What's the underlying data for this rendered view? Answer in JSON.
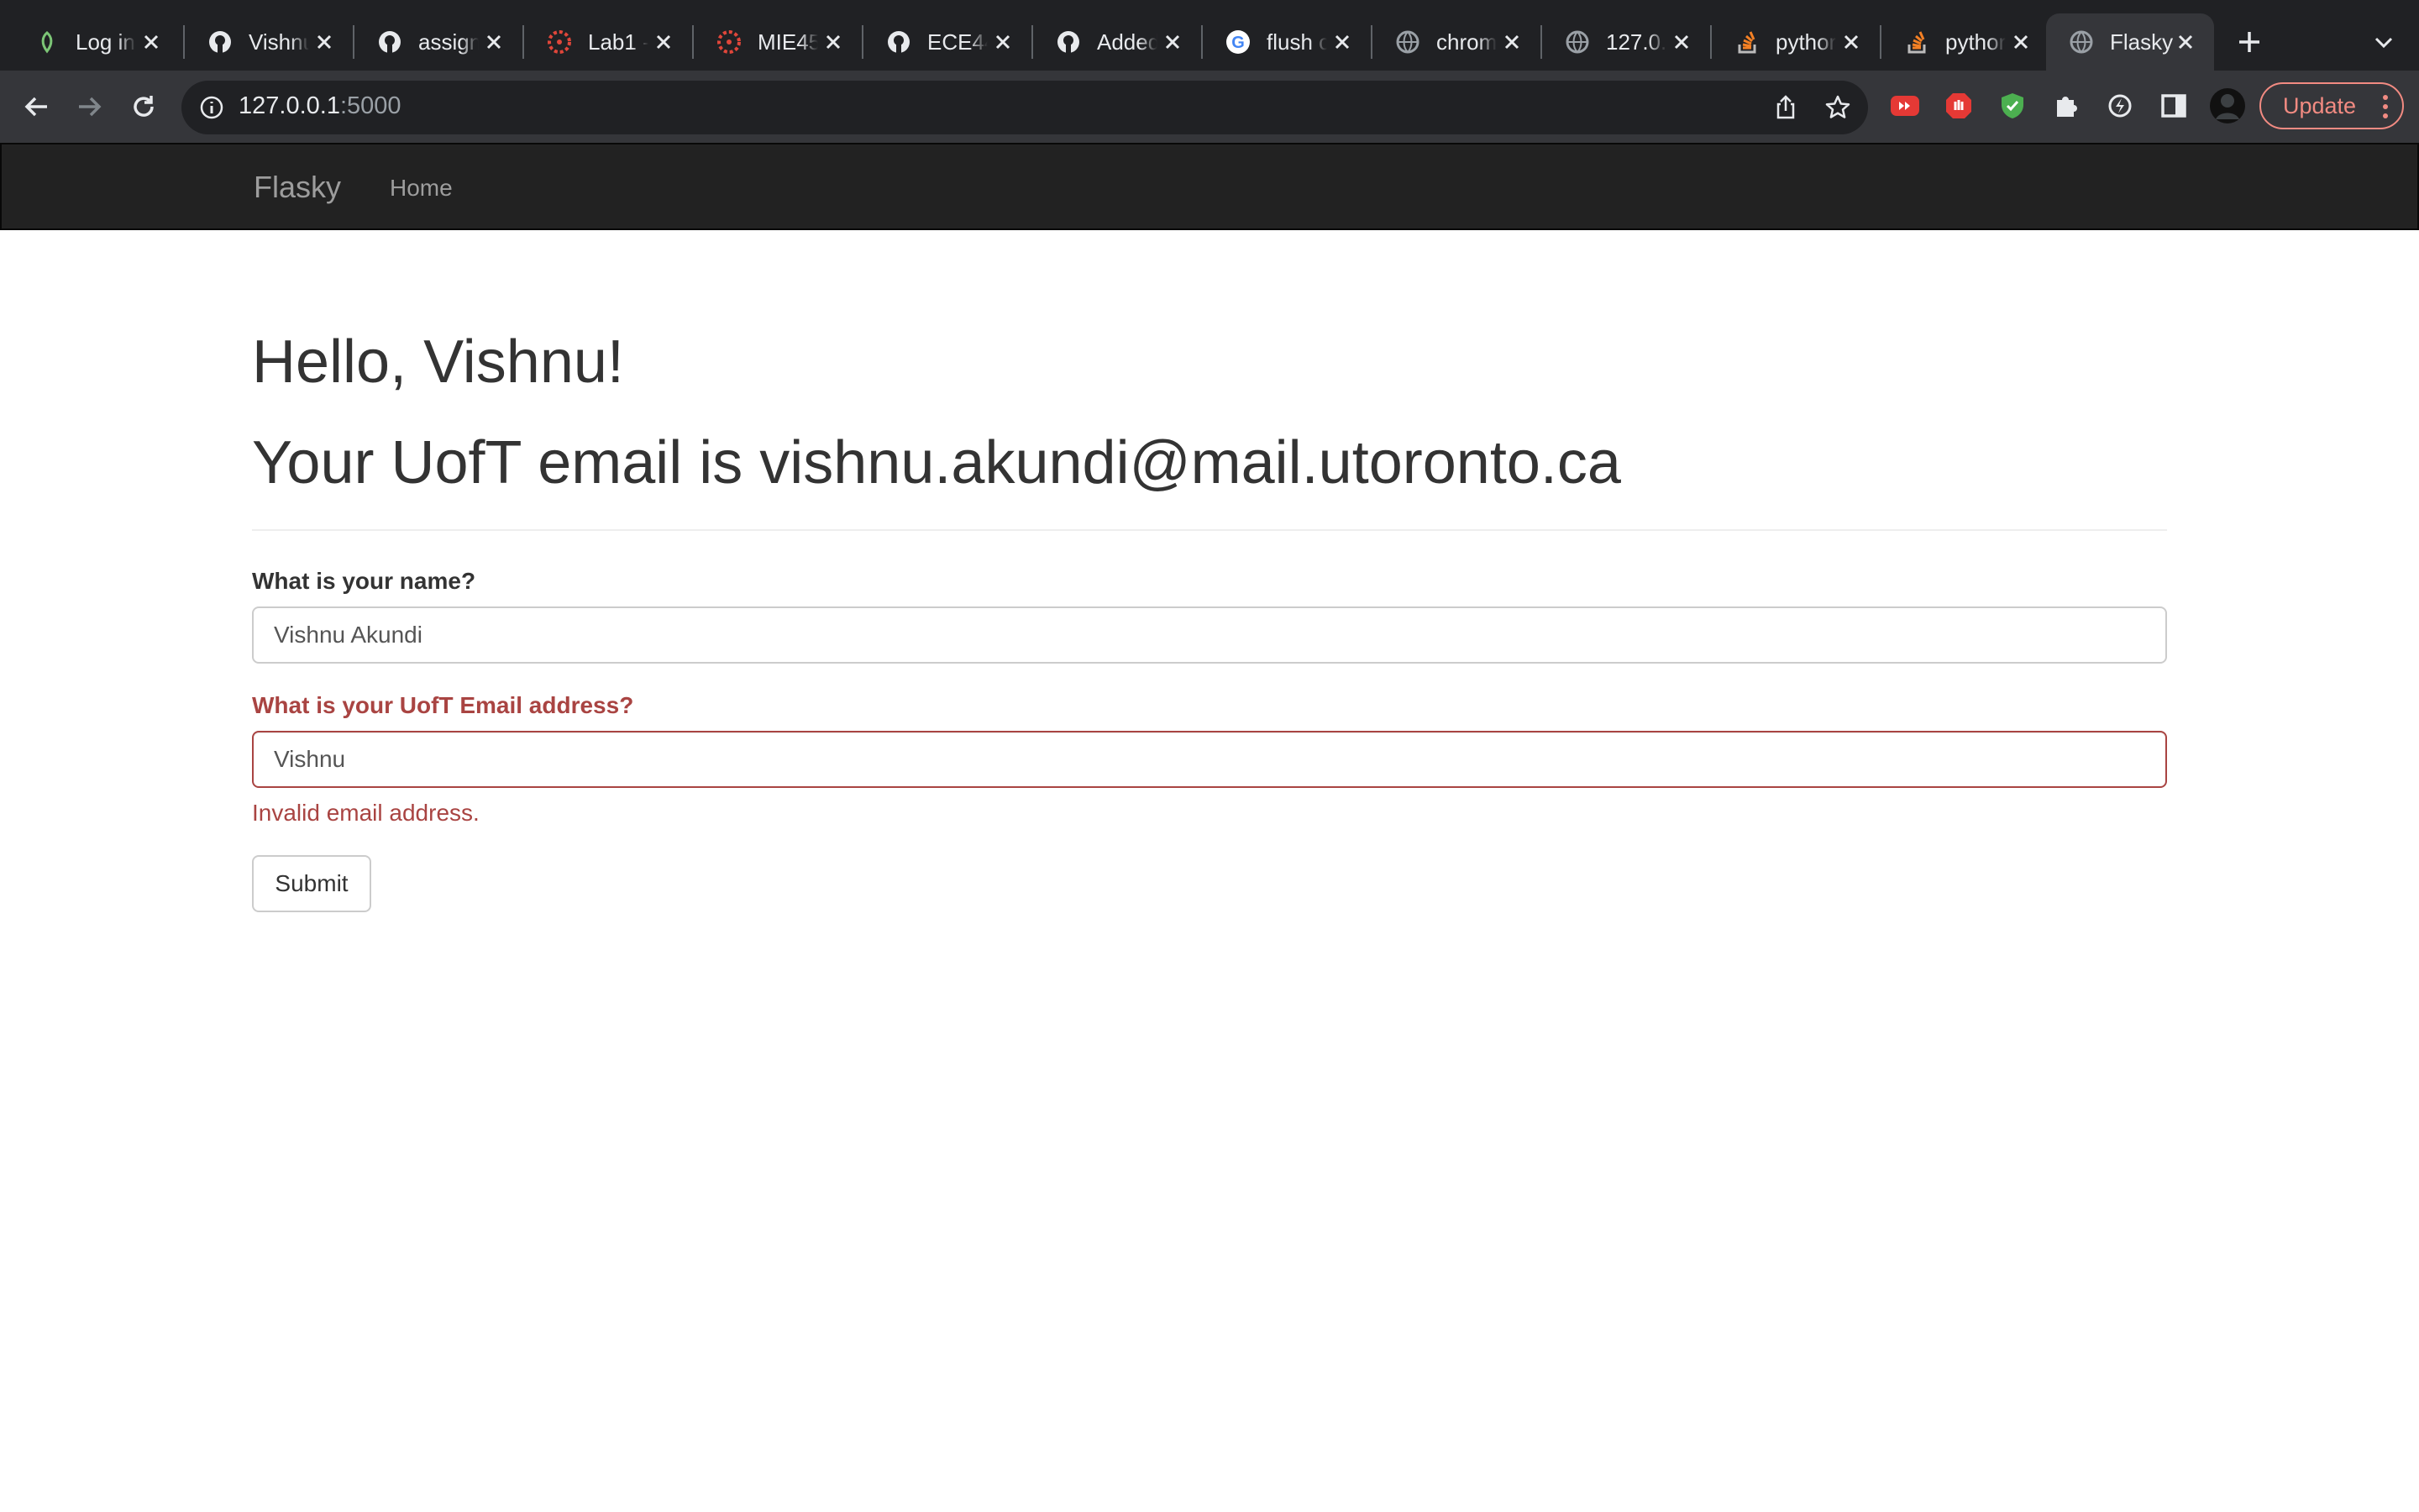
{
  "browser": {
    "tabs": [
      {
        "title": "Log in",
        "icon": "leaf-icon"
      },
      {
        "title": "Vishnu",
        "icon": "github-icon"
      },
      {
        "title": "assign",
        "icon": "github-icon"
      },
      {
        "title": "Lab1 -",
        "icon": "canvas-icon"
      },
      {
        "title": "MIE45",
        "icon": "canvas-icon"
      },
      {
        "title": "ECE44",
        "icon": "github-icon"
      },
      {
        "title": "Added",
        "icon": "github-icon"
      },
      {
        "title": "flush c",
        "icon": "google-icon"
      },
      {
        "title": "chrom",
        "icon": "globe-icon"
      },
      {
        "title": "127.0.",
        "icon": "globe-icon"
      },
      {
        "title": "pythor",
        "icon": "stackoverflow-icon"
      },
      {
        "title": "pythor",
        "icon": "stackoverflow-icon"
      },
      {
        "title": "Flasky",
        "icon": "globe-icon",
        "active": true
      }
    ],
    "url_host": "127.0.0.1",
    "url_port": ":5000",
    "update_label": "Update",
    "colors": {
      "frame": "#202124",
      "toolbar": "#35363a",
      "update": "#f28b82"
    }
  },
  "navbar": {
    "brand": "Flasky",
    "home": "Home"
  },
  "page": {
    "greeting": "Hello, Vishnu!",
    "email_line": "Your UofT email is vishnu.akundi@mail.utoronto.ca"
  },
  "form": {
    "name_label": "What is your name?",
    "name_value": "Vishnu Akundi",
    "email_label": "What is your UofT Email address?",
    "email_value": "Vishnu",
    "email_error": "Invalid email address.",
    "submit_label": "Submit",
    "error_color": "#a94442"
  }
}
